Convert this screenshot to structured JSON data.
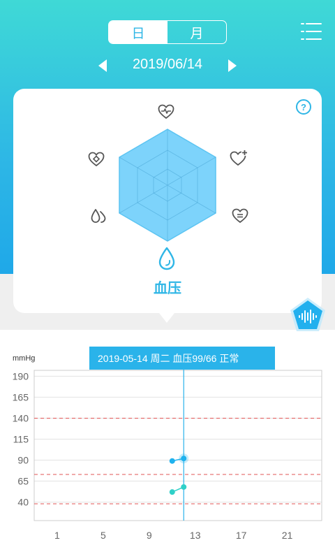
{
  "header": {
    "tabs": [
      {
        "label": "日",
        "active": true
      },
      {
        "label": "月",
        "active": false
      }
    ],
    "menu_icon": "menu-icon"
  },
  "date_nav": {
    "date": "2019/06/14",
    "prev_icon": "triangle-left-icon",
    "next_icon": "triangle-right-icon"
  },
  "card": {
    "help_label": "?",
    "metric_label": "血压",
    "icons": [
      "heart-pulse-icon",
      "heart-plus-icon",
      "heart-list-icon",
      "blood-drop-icon",
      "double-drop-icon",
      "heart-diamond-icon"
    ]
  },
  "tooltip": {
    "text": "2019-05-14 周二  血压99/66 正常"
  },
  "colors": {
    "accent": "#2fb6e6",
    "gradient_top": "#3fd9d6",
    "gradient_bottom": "#1fa8e8",
    "radar_fill": "#7dd3fb",
    "threshold_line": "#e05555",
    "point_upper": "#1fb2ee",
    "point_lower": "#2fd0c8"
  },
  "chart_data": {
    "type": "line",
    "ylabel": "mmHg",
    "y_ticks": [
      190,
      165,
      140,
      115,
      90,
      65,
      40
    ],
    "x_ticks": [
      1,
      5,
      9,
      13,
      17,
      21
    ],
    "ylim": [
      18,
      197
    ],
    "xlim": [
      -1,
      24
    ],
    "thresholds": [
      140,
      73,
      38
    ],
    "cursor_x": 12,
    "series": [
      {
        "values": [
          [
            11,
            89
          ],
          [
            12,
            92
          ]
        ]
      },
      {
        "values": [
          [
            11,
            52
          ],
          [
            12,
            58
          ]
        ]
      }
    ]
  }
}
